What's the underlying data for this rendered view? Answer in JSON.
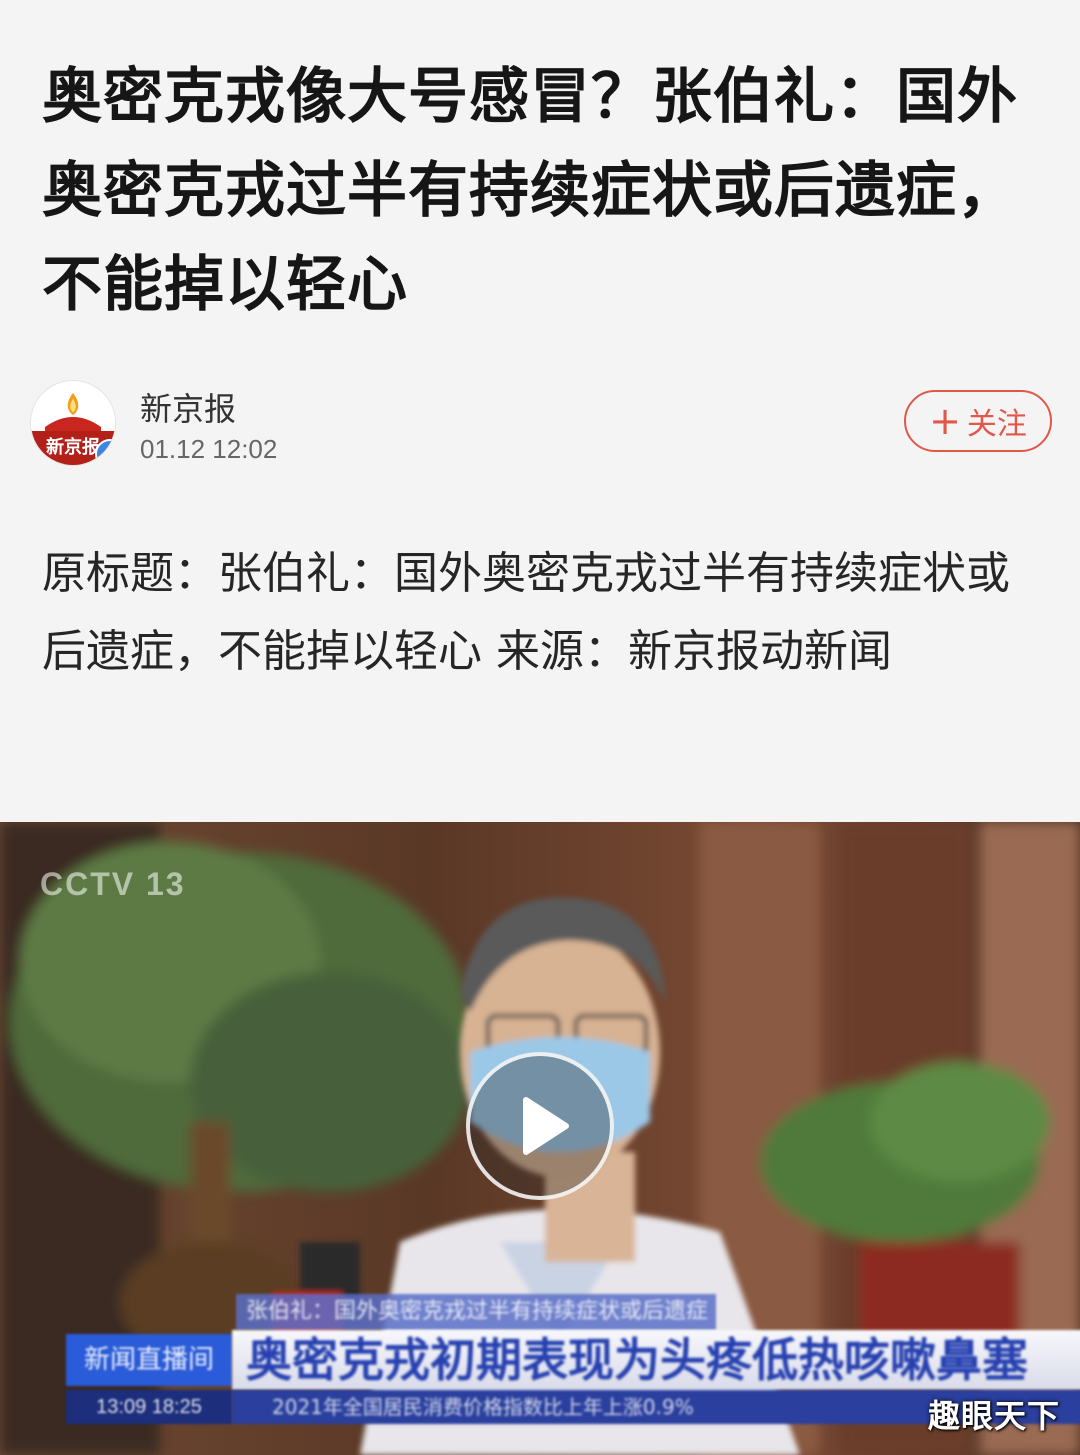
{
  "article": {
    "headline": "奥密克戎像大号感冒？张伯礼：国外奥密克戎过半有持续症状或后遗症，不能掉以轻心",
    "body": "原标题：张伯礼：国外奥密克戎过半有持续症状或后遗症，不能掉以轻心 来源：新京报动新闻"
  },
  "author": {
    "name": "新京报",
    "time": "01.12 12:02",
    "avatar_text": "新京报",
    "avatar_icon": "newspaper-logo-icon",
    "verified_icon": "verified-check-icon",
    "follow_label": "关注",
    "follow_icon": "plus-icon"
  },
  "video": {
    "channel_logo": "CCTV 13",
    "lower_third_top": "张伯礼：国外奥密克戎过半有持续症状或后遗症",
    "lower_third_tag": "新闻直播间",
    "lower_third_main": "奥密克戎初期表现为头疼低热咳嗽鼻塞",
    "lower_third_time": "13:09  18:25",
    "ticker": "2021年全国居民消费价格指数比上年上涨0.9%",
    "play_icon": "play-icon"
  },
  "watermark": "趣眼天下",
  "colors": {
    "accent": "#e0584a",
    "background": "#f4f4f4",
    "verified": "#3a86e0",
    "news_blue": "#2a5bd8"
  }
}
